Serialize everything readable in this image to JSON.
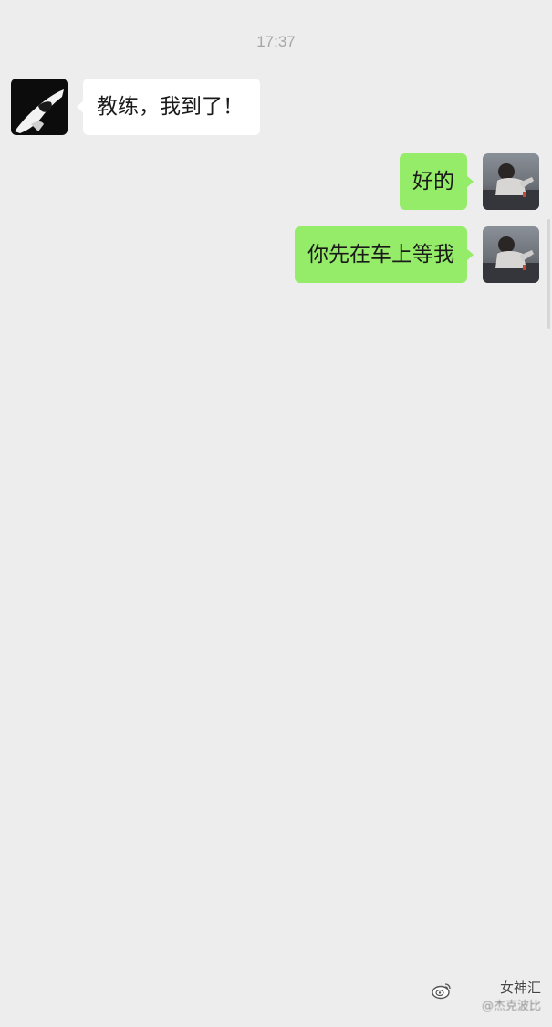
{
  "chat": {
    "timestamp": "17:37",
    "messages": [
      {
        "sender": "other",
        "text": "教练，我到了！"
      },
      {
        "sender": "self",
        "text": "好的"
      },
      {
        "sender": "self",
        "text": "你先在车上等我"
      }
    ]
  },
  "watermark": {
    "line1": "女神汇",
    "line2": "@杰克波比"
  },
  "colors": {
    "background": "#ededed",
    "bubble_self": "#95ec69",
    "bubble_other": "#ffffff",
    "timestamp": "#a6a6a6"
  }
}
